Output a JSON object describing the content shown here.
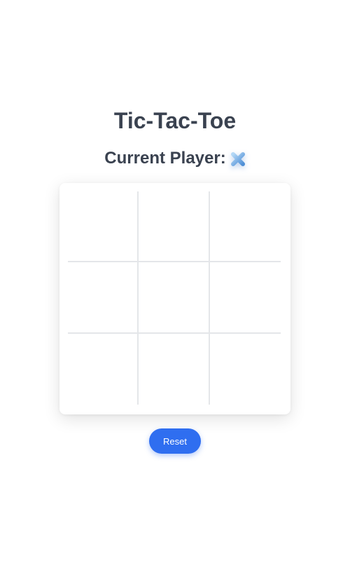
{
  "title": "Tic-Tac-Toe",
  "status": {
    "label": "Current Player:",
    "current_player_icon": "x-icon",
    "current_player": "X"
  },
  "board": {
    "cells": [
      "",
      "",
      "",
      "",
      "",
      "",
      "",
      "",
      ""
    ]
  },
  "controls": {
    "reset_label": "Reset"
  },
  "colors": {
    "text": "#3a4250",
    "accent": "#2f6ef0",
    "x_light": "#9cc8f0",
    "x_dark": "#4f8fd6",
    "grid_line": "#e4e6e9"
  }
}
